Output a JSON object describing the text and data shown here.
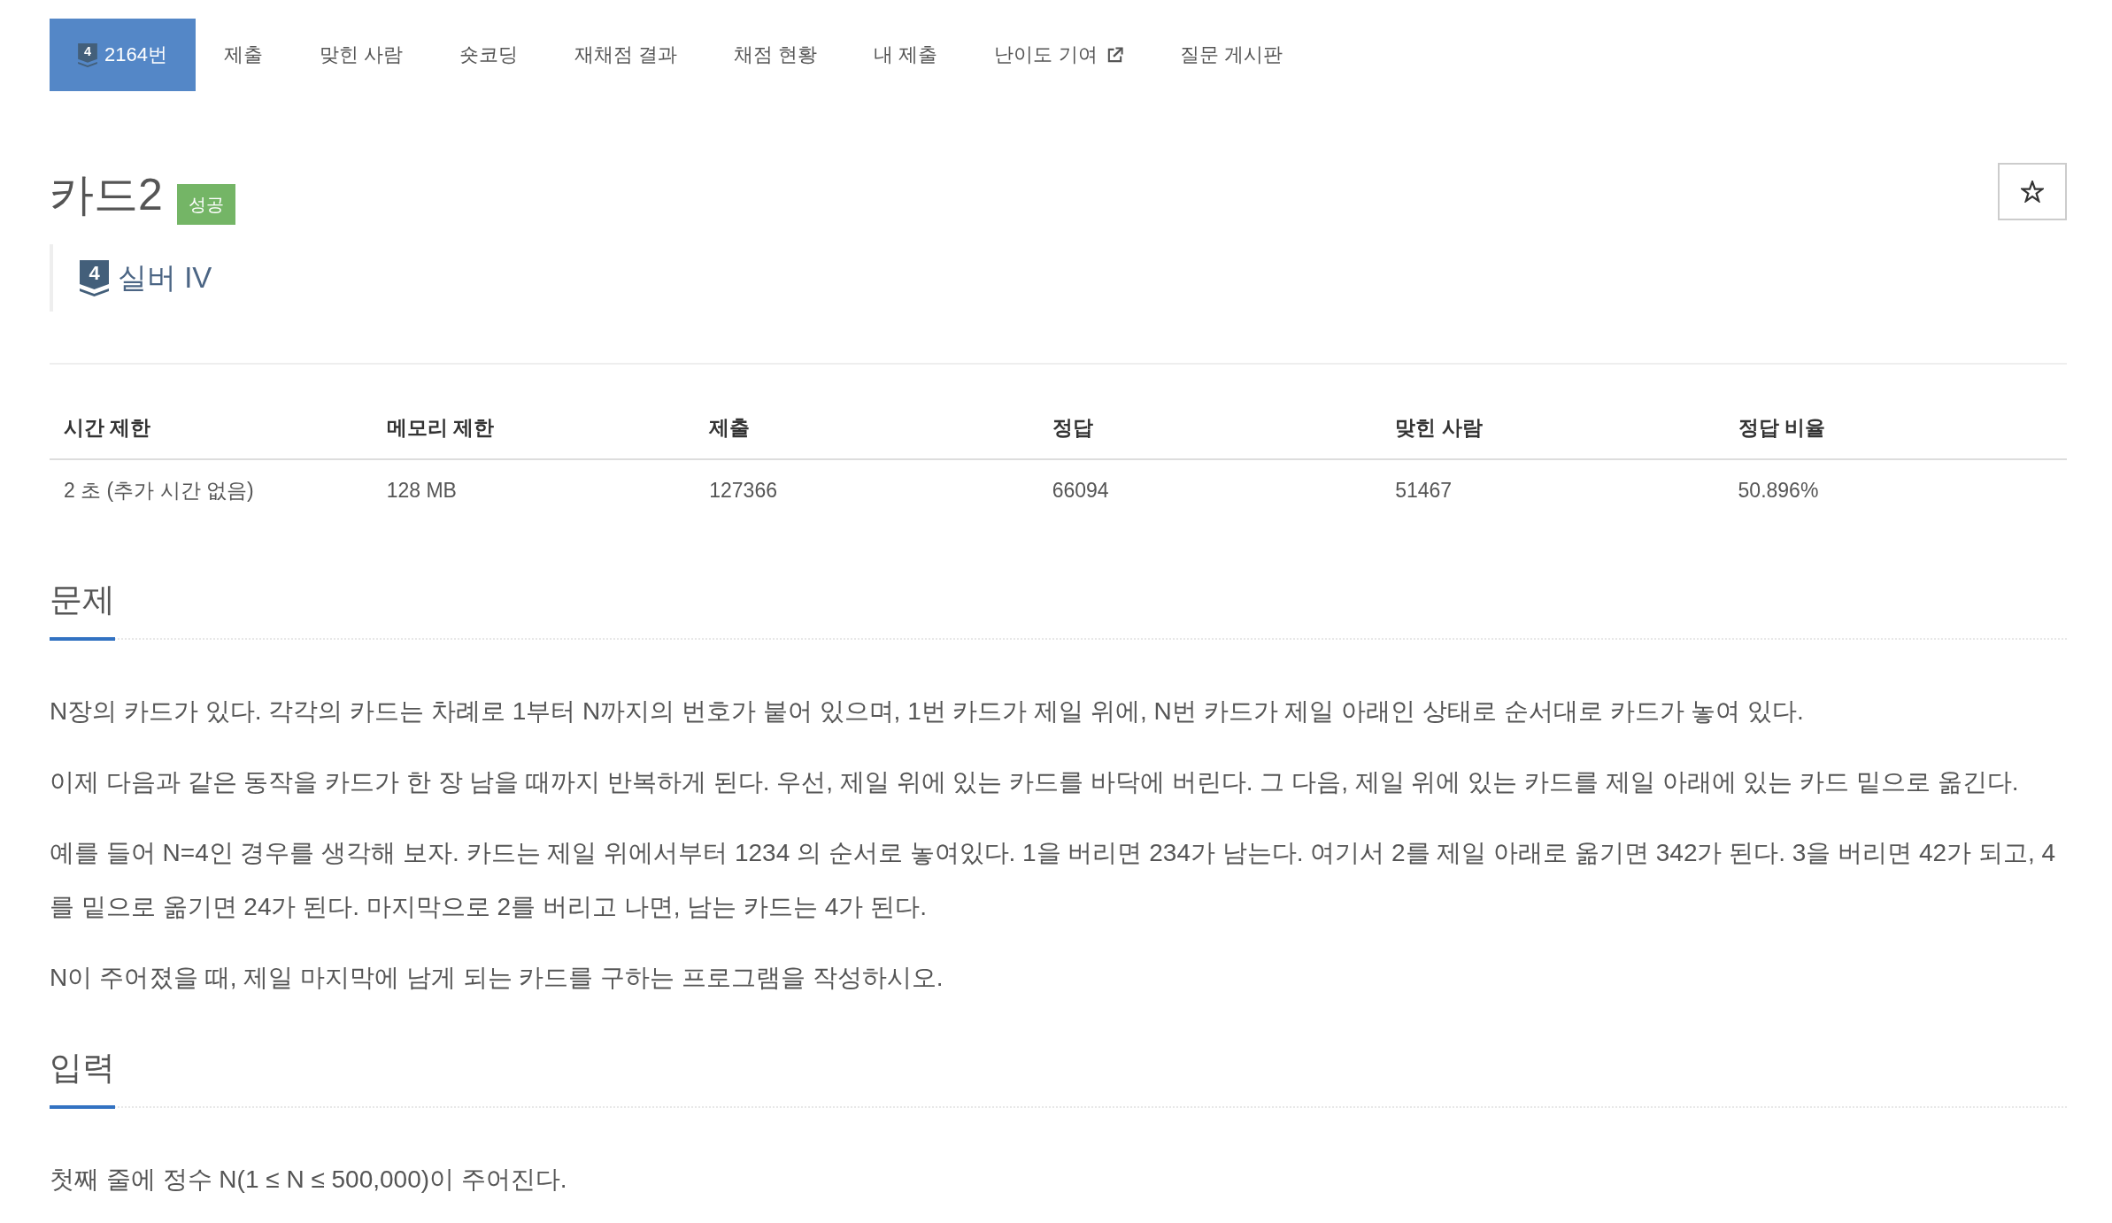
{
  "nav": {
    "tabs": [
      {
        "kind": "problem",
        "badge": "4",
        "label": "2164번",
        "selected": true
      },
      {
        "kind": "plain",
        "label": "제출",
        "selected": false
      },
      {
        "kind": "plain",
        "label": "맞힌 사람",
        "selected": false
      },
      {
        "kind": "plain",
        "label": "숏코딩",
        "selected": false
      },
      {
        "kind": "plain",
        "label": "재채점 결과",
        "selected": false
      },
      {
        "kind": "plain",
        "label": "채점 현황",
        "selected": false
      },
      {
        "kind": "plain",
        "label": "내 제출",
        "selected": false
      },
      {
        "kind": "external",
        "label": "난이도 기여",
        "selected": false
      },
      {
        "kind": "plain",
        "label": "질문 게시판",
        "selected": false
      }
    ]
  },
  "problem": {
    "title": "카드2",
    "status_tag": "성공",
    "favorite": {
      "starred": false
    },
    "tier": {
      "badge": "4",
      "label": "실버 IV"
    }
  },
  "limits_table": {
    "columns": [
      "시간 제한",
      "메모리 제한",
      "제출",
      "정답",
      "맞힌 사람",
      "정답 비율"
    ],
    "rows": [
      [
        "2 초 (추가 시간 없음)",
        "128 MB",
        "127366",
        "66094",
        "51467",
        "50.896%"
      ]
    ]
  },
  "sections": [
    {
      "title": "문제",
      "paragraphs": [
        "N장의 카드가 있다. 각각의 카드는 차례로 1부터 N까지의 번호가 붙어 있으며, 1번 카드가 제일 위에, N번 카드가 제일 아래인 상태로 순서대로 카드가 놓여 있다.",
        "이제 다음과 같은 동작을 카드가 한 장 남을 때까지 반복하게 된다. 우선, 제일 위에 있는 카드를 바닥에 버린다. 그 다음, 제일 위에 있는 카드를 제일 아래에 있는 카드 밑으로 옮긴다.",
        "예를 들어 N=4인 경우를 생각해 보자. 카드는 제일 위에서부터 1234 의 순서로 놓여있다. 1을 버리면 234가 남는다. 여기서 2를 제일 아래로 옮기면 342가 된다. 3을 버리면 42가 되고, 4를 밑으로 옮기면 24가 된다. 마지막으로 2를 버리고 나면, 남는 카드는 4가 된다.",
        "N이 주어졌을 때, 제일 마지막에 남게 되는 카드를 구하는 프로그램을 작성하시오."
      ]
    },
    {
      "title": "입력",
      "paragraphs": [
        "첫째 줄에 정수 N(1 ≤ N ≤ 500,000)이 주어진다."
      ]
    }
  ]
}
